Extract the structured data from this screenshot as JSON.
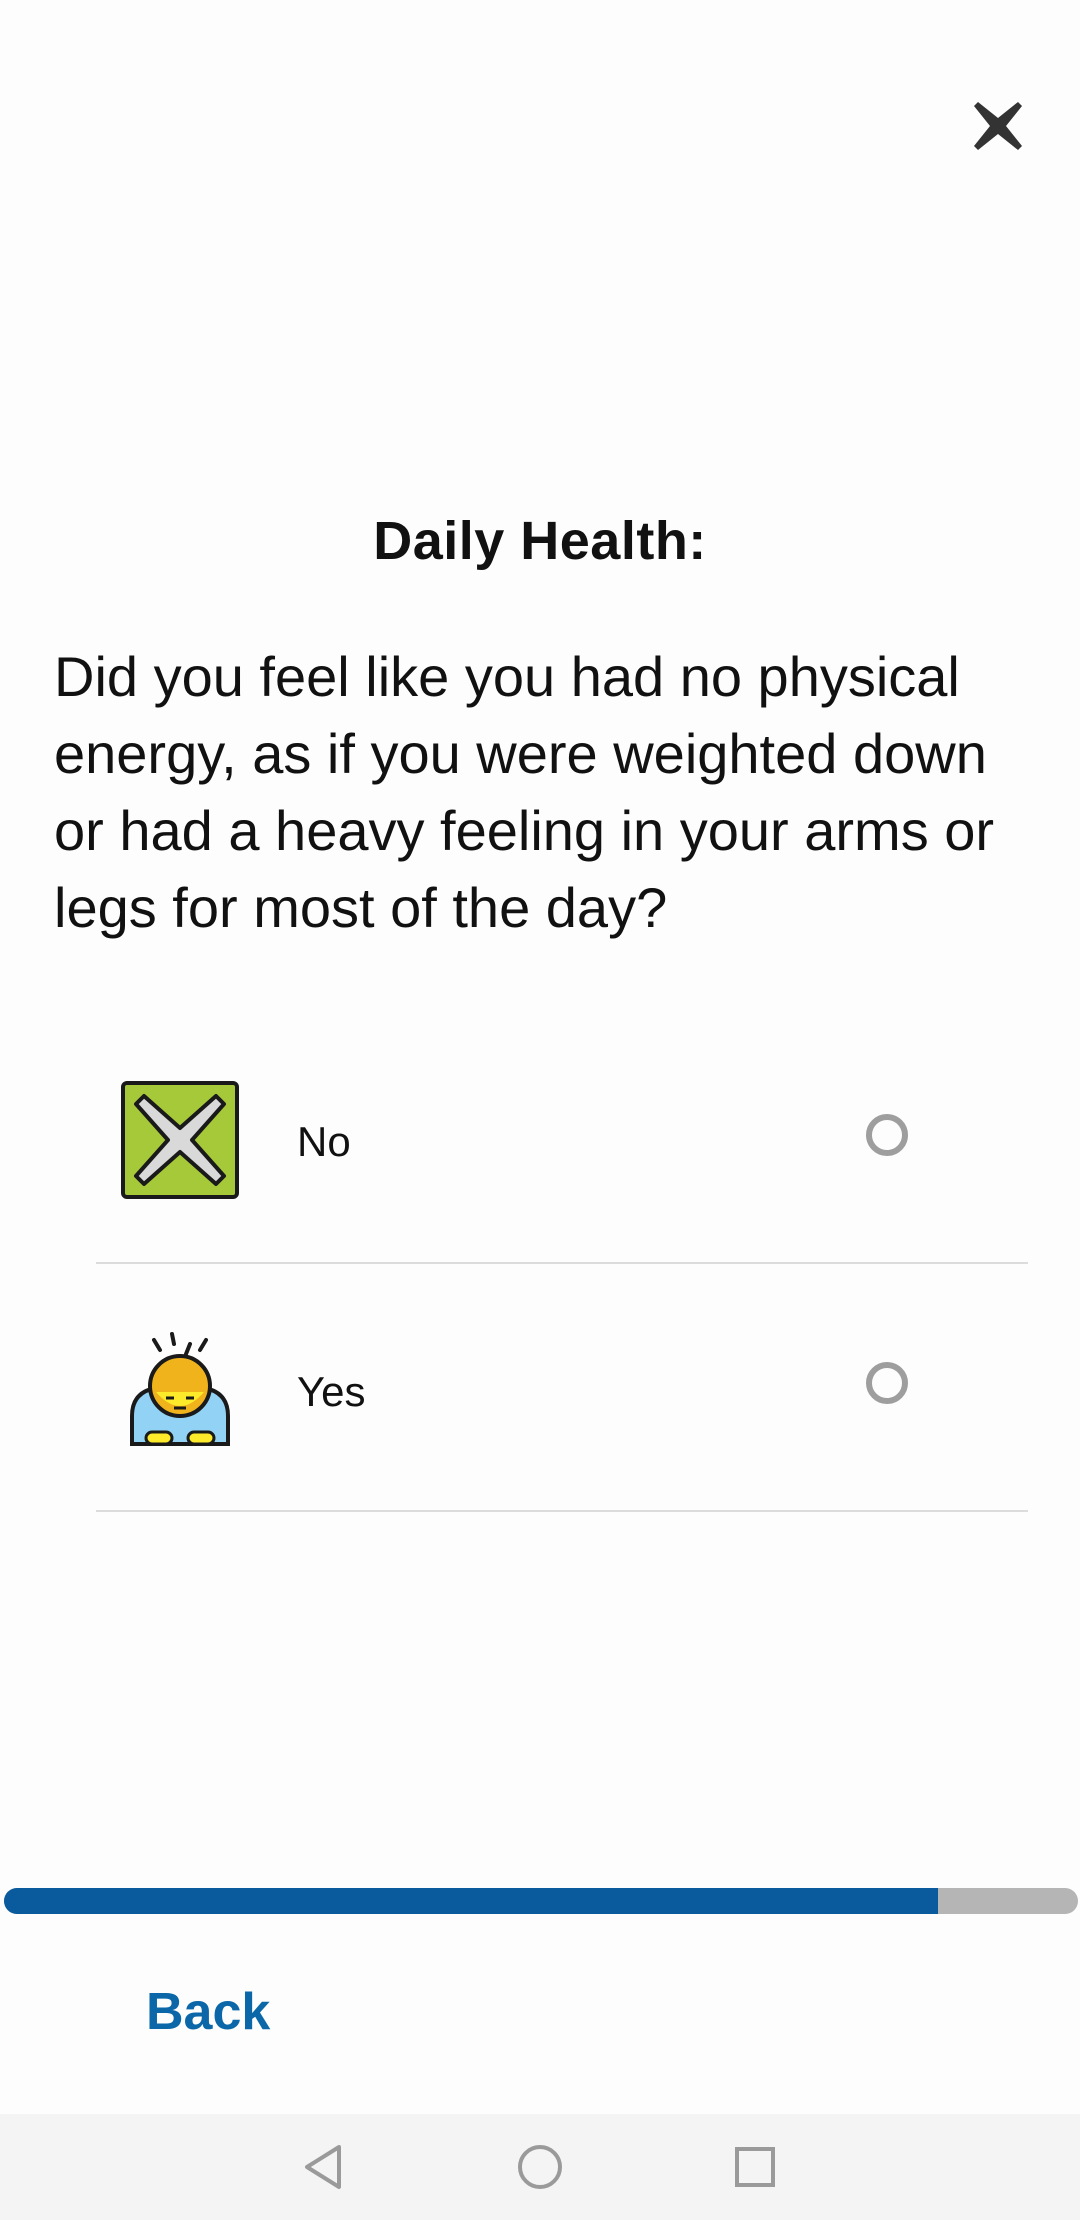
{
  "header": {
    "close_icon": "close-icon"
  },
  "survey": {
    "title": "Daily Health:",
    "question": "Did you feel like you had no physical energy, as if you were weighted down or had a heavy feeling in your arms or legs for most of the day?",
    "options": [
      {
        "label": "No",
        "icon": "cross-mark-icon",
        "selected": false
      },
      {
        "label": "Yes",
        "icon": "tired-person-icon",
        "selected": false
      }
    ]
  },
  "progress": {
    "value_percent": 87,
    "fill_color": "#0a5a9e",
    "track_color": "#b5b5b5"
  },
  "footer": {
    "back_label": "Back",
    "back_color": "#0b67a8"
  },
  "system_nav": {
    "icons": [
      "nav-back-icon",
      "nav-home-icon",
      "nav-recent-icon"
    ]
  }
}
